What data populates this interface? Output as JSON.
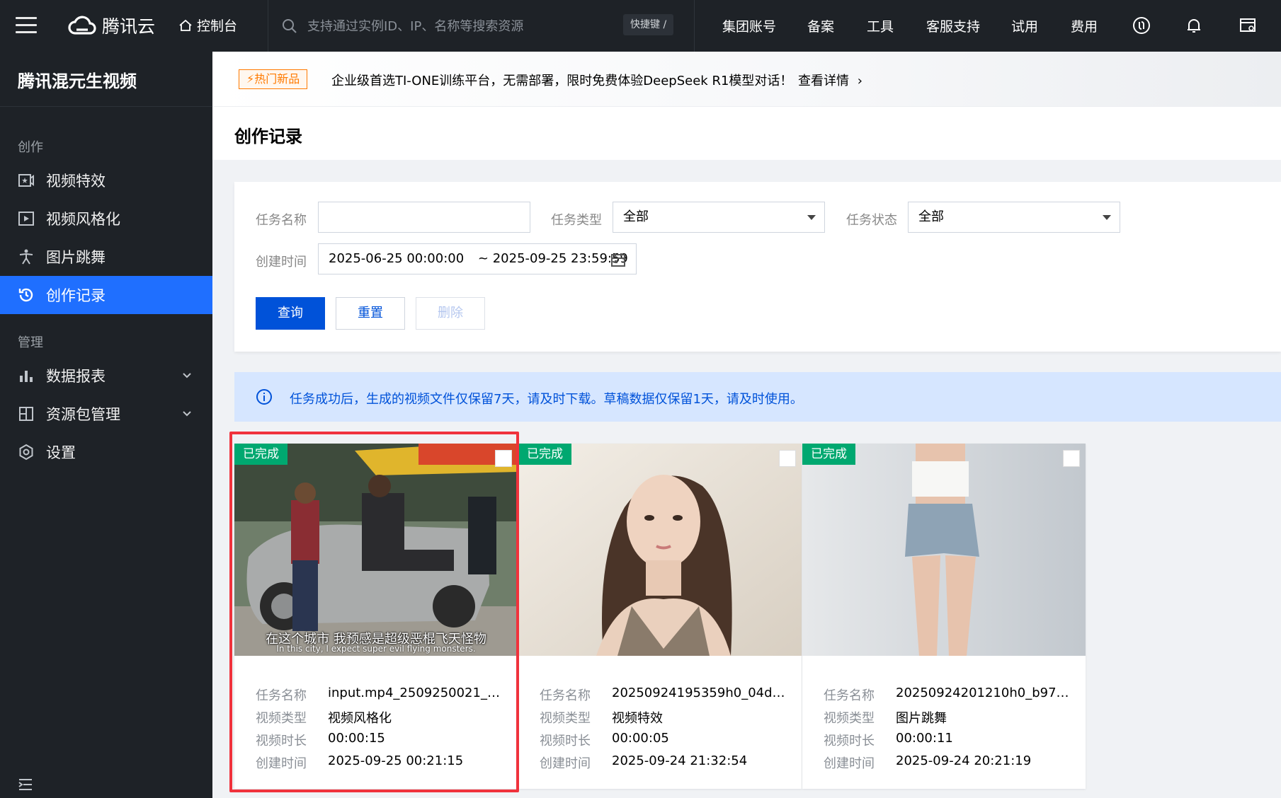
{
  "topbar": {
    "logo_text": "腾讯云",
    "console_label": "控制台",
    "search_placeholder": "支持通过实例ID、IP、名称等搜索资源",
    "shortcut_label": "快捷键 /",
    "nav": [
      "集团账号",
      "备案",
      "工具",
      "客服支持",
      "试用",
      "费用"
    ]
  },
  "sidebar": {
    "product_title": "腾讯混元生视频",
    "group_create": "创作",
    "group_manage": "管理",
    "items": [
      {
        "label": "视频特效",
        "icon": "video-effect-icon"
      },
      {
        "label": "视频风格化",
        "icon": "video-play-icon"
      },
      {
        "label": "图片跳舞",
        "icon": "dance-icon"
      },
      {
        "label": "创作记录",
        "icon": "history-icon"
      },
      {
        "label": "数据报表",
        "icon": "bar-chart-icon"
      },
      {
        "label": "资源包管理",
        "icon": "package-icon"
      },
      {
        "label": "设置",
        "icon": "settings-icon"
      }
    ]
  },
  "banner": {
    "tag": "热门新品",
    "text": "企业级首选TI-ONE训练平台，无需部署，限时免费体验DeepSeek R1模型对话！",
    "more": "查看详情"
  },
  "page": {
    "title": "创作记录"
  },
  "filter": {
    "task_name_label": "任务名称",
    "task_name_value": "",
    "task_type_label": "任务类型",
    "task_type_value": "全部",
    "task_status_label": "任务状态",
    "task_status_value": "全部",
    "create_time_label": "创建时间",
    "start_time": "2025-06-25 00:00:00",
    "end_time": "~ 2025-09-25 23:59:59",
    "query_button": "查询",
    "reset_button": "重置",
    "delete_button": "删除"
  },
  "notice": {
    "text": "任务成功后，生成的视频文件仅保留7天，请及时下载。草稿数据仅保留1天，请及时使用。"
  },
  "cards": [
    {
      "status": "已完成",
      "subtitle_cn": "在这个城市 我预感是超级恶棍飞天怪物",
      "subtitle_en": "In this city, I expect super evil flying monsters.",
      "labels": {
        "name": "任务名称",
        "type": "视频类型",
        "duration": "视频时长",
        "created": "创建时间"
      },
      "name": "input.mp4_2509250021_…",
      "type": "视频风格化",
      "duration": "00:00:15",
      "created": "2025-09-25 00:21:15"
    },
    {
      "status": "已完成",
      "labels": {
        "name": "任务名称",
        "type": "视频类型",
        "duration": "视频时长",
        "created": "创建时间"
      },
      "name": "20250924195359h0_04d…",
      "type": "视频特效",
      "duration": "00:00:05",
      "created": "2025-09-24 21:32:54"
    },
    {
      "status": "已完成",
      "labels": {
        "name": "任务名称",
        "type": "视频类型",
        "duration": "视频时长",
        "created": "创建时间"
      },
      "name": "20250924201210h0_b97…",
      "type": "图片跳舞",
      "duration": "00:00:11",
      "created": "2025-09-24 20:21:19"
    }
  ],
  "colors": {
    "topbar_bg": "#1e2227",
    "active_blue": "#1f6fff",
    "primary": "#0052d9",
    "status_green": "#00a870",
    "hot_tag": "#ff7a00",
    "highlight_red": "#f0323c"
  }
}
